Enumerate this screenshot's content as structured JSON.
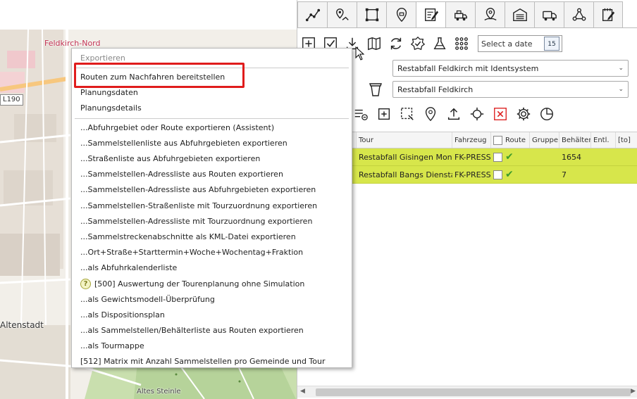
{
  "map": {
    "labels": {
      "feldkirch_nord": "Feldkirch-Nord",
      "altenstadt": "Altenstadt",
      "altes_steinle": "Altes Steinle"
    },
    "road_badge": "L190"
  },
  "tabs": [
    {
      "icon": "route-line-icon",
      "active": false
    },
    {
      "icon": "map-pin-route-icon",
      "active": false
    },
    {
      "icon": "area-select-icon",
      "active": false
    },
    {
      "icon": "location-pin-icon",
      "active": false
    },
    {
      "icon": "edit-document-icon",
      "active": true
    },
    {
      "icon": "vehicle-icon",
      "active": false
    },
    {
      "icon": "map-location-icon",
      "active": false
    },
    {
      "icon": "depot-building-icon",
      "active": false
    },
    {
      "icon": "truck-icon",
      "active": false
    },
    {
      "icon": "network-icon",
      "active": false
    },
    {
      "icon": "notepad-icon",
      "active": false
    }
  ],
  "toolbar1": {
    "date_placeholder": "Select a date",
    "calendar_day": "15"
  },
  "selects": {
    "tour_plan": "Restabfall Feldkirch mit Identsystem",
    "fraction": "Restabfall Feldkirch"
  },
  "table": {
    "headers": [
      "",
      "Tour",
      "Fahrzeug",
      "Route",
      "Gruppe",
      "Behälter",
      "Entl.",
      "[to]"
    ],
    "rows": [
      {
        "tour": "Restabfall Gisingen Montag",
        "vehicle": "FK-PRESS",
        "route": "✔",
        "group": "",
        "containers": "1654",
        "entl": "",
        "to": ""
      },
      {
        "tour": "Restabfall Bangs Dienstag",
        "vehicle": "FK-PRESS",
        "route": "✔",
        "group": "",
        "containers": "7",
        "entl": "",
        "to": ""
      }
    ],
    "row_color": "#d7e64b"
  },
  "context_menu": {
    "header": "Exportieren",
    "group1": [
      "Routen zum Nachfahren bereitstellen",
      "Planungsdaten",
      "Planungsdetails"
    ],
    "group2": [
      "...Abfuhrgebiet oder Route exportieren (Assistent)",
      "...Sammelstellenliste aus Abfuhrgebieten exportieren",
      "...Straßenliste aus Abfuhrgebieten exportieren",
      "...Sammelstellen-Adressliste aus Routen exportieren",
      "...Sammelstellen-Adressliste aus Abfuhrgebieten exportieren",
      "...Sammelstellen-Straßenliste mit Tourzuordnung exportieren",
      "...Sammelstellen-Adressliste mit Tourzuordnung exportieren",
      "...Sammelstreckenabschnitte als KML-Datei exportieren",
      "...Ort+Straße+Starttermin+Woche+Wochentag+Fraktion",
      "...als Abfuhrkalenderliste",
      "[500] Auswertung der Tourenplanung ohne Simulation",
      "...als Gewichtsmodell-Überprüfung",
      "...als Dispositionsplan",
      "...als Sammelstellen/Behälterliste aus Routen exportieren",
      "...als Tourmappe",
      "[512] Matrix mit Anzahl Sammelstellen pro Gemeinde und Tour"
    ],
    "help_icon": "?",
    "highlight_color": "#e01c1c"
  }
}
